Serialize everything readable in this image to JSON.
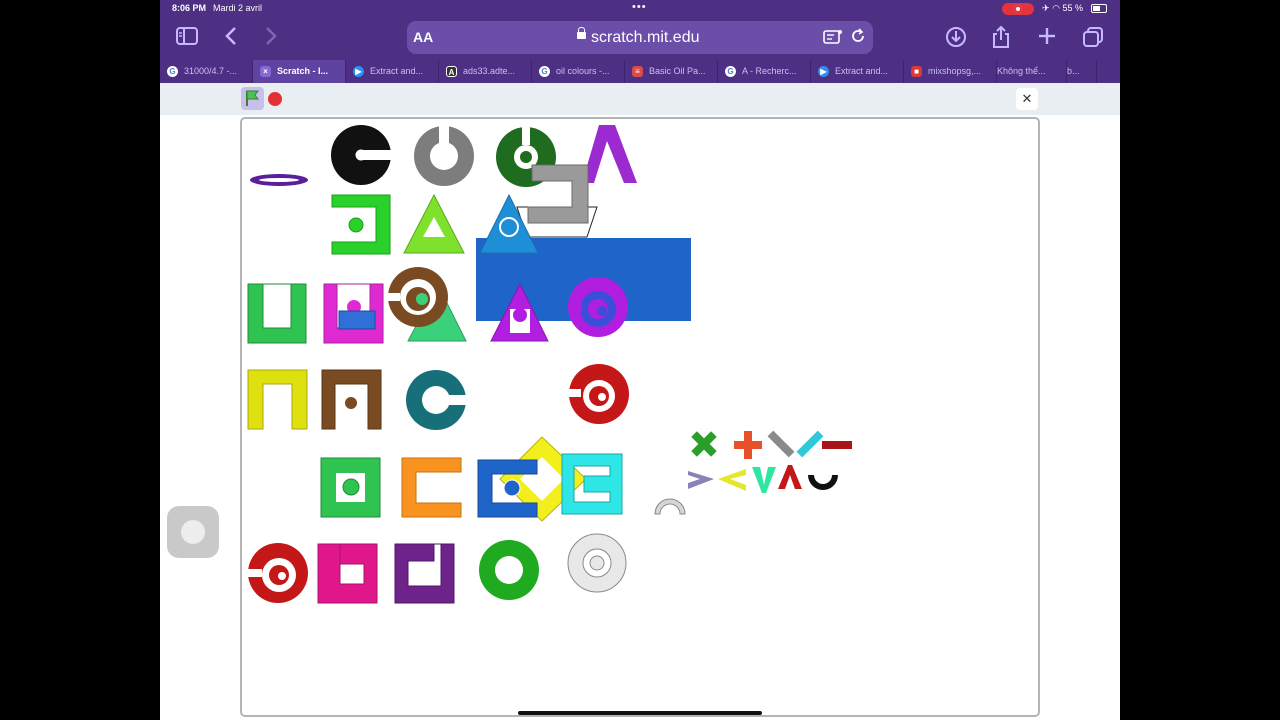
{
  "status_bar": {
    "time": "8:06 PM",
    "date": "Mardi 2 avril",
    "battery": "55 %",
    "icons": [
      "screen-record-icon",
      "airplane-icon",
      "wifi-icon",
      "battery-icon"
    ]
  },
  "toolbar": {
    "text_size": "AA",
    "url": "scratch.mit.edu",
    "icons": [
      "sidebar-icon",
      "back-icon",
      "forward-icon",
      "download-icon",
      "share-icon",
      "new-tab-icon",
      "tabs-icon"
    ]
  },
  "tabs": [
    {
      "label": "31000/4.7 -...",
      "favicon": "G",
      "color": "#4b7bd6"
    },
    {
      "label": "Scratch - I...",
      "favicon": "×",
      "color": "#8a67d6",
      "active": true
    },
    {
      "label": "Extract and...",
      "favicon": "▶",
      "color": "#2f8ff0"
    },
    {
      "label": "ads33.adte...",
      "favicon": "A",
      "color": "#333333"
    },
    {
      "label": "oil colours -...",
      "favicon": "G",
      "color": "#4b7bd6"
    },
    {
      "label": "Basic Oil Pa...",
      "favicon": "≡",
      "color": "#d94c4c"
    },
    {
      "label": "A - Recherc...",
      "favicon": "G",
      "color": "#4b7bd6"
    },
    {
      "label": "Extract and...",
      "favicon": "▶",
      "color": "#2f8ff0"
    },
    {
      "label": "mixshopsg,...",
      "favicon": "■",
      "color": "#d93a3a"
    },
    {
      "label": "Không thể...",
      "favicon": "",
      "color": "#000000"
    },
    {
      "label": "b...",
      "favicon": "",
      "color": "#000000"
    }
  ],
  "scratch": {
    "controls": [
      "green-flag-icon",
      "stop-icon",
      "exit-fullscreen-icon"
    ]
  },
  "colors": {
    "browser_chrome": "#4d2f83",
    "address_bar": "#6a4ea8",
    "stage_border": "#b4b4b4",
    "blue_rectangle": "#1f64c8"
  }
}
